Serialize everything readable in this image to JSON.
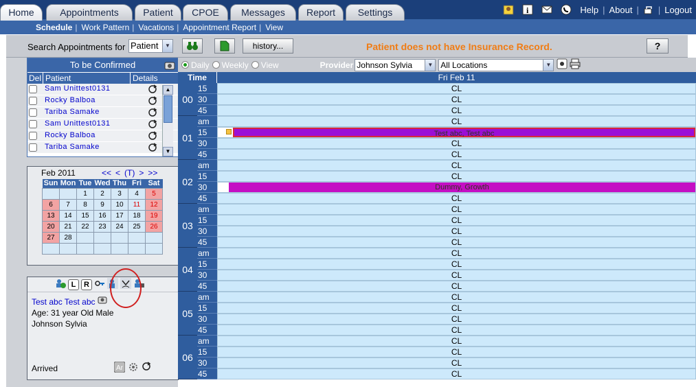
{
  "tabs": [
    {
      "label": "Home",
      "active": true
    },
    {
      "label": "Appointments",
      "active": false
    },
    {
      "label": "Patient",
      "active": false
    },
    {
      "label": "CPOE",
      "active": false
    },
    {
      "label": "Messages",
      "active": false
    },
    {
      "label": "Report",
      "active": false
    },
    {
      "label": "Settings",
      "active": false
    }
  ],
  "top_links": {
    "help": "Help",
    "about": "About",
    "logout": "Logout"
  },
  "subnav": [
    "Schedule",
    "Work Pattern",
    "Vacations",
    "Appointment Report",
    "View"
  ],
  "search": {
    "label": "Search Appointments for",
    "selected": "Patient",
    "history_button": "history..."
  },
  "warning": "Patient does not have Insurance Record.",
  "help_button": "?",
  "to_confirm": {
    "title": "To be Confirmed",
    "columns": [
      "Del",
      "Patient",
      "Details"
    ],
    "rows": [
      "Sam Unittest0131",
      "Rocky Balboa",
      "Tariba Samake",
      "Sam Unittest0131",
      "Rocky Balboa",
      "Tariba Samake"
    ]
  },
  "calendar": {
    "month": "Feb 2011",
    "nav": [
      "<<",
      "<",
      "(T)",
      ">",
      ">>"
    ],
    "weekdays": [
      "Sun",
      "Mon",
      "Tue",
      "Wed",
      "Thu",
      "Fri",
      "Sat"
    ],
    "weeks": [
      [
        "",
        "",
        "1",
        "2",
        "3",
        "4",
        "5"
      ],
      [
        "6",
        "7",
        "8",
        "9",
        "10",
        "11",
        "12"
      ],
      [
        "13",
        "14",
        "15",
        "16",
        "17",
        "18",
        "19"
      ],
      [
        "20",
        "21",
        "22",
        "23",
        "24",
        "25",
        "26"
      ],
      [
        "27",
        "28",
        "",
        "",
        "",
        "",
        ""
      ],
      [
        "",
        "",
        "",
        "",
        "",
        "",
        ""
      ]
    ],
    "today": "11"
  },
  "patient_info": {
    "name": "Test abc Test abc",
    "age": "Age: 31 year  Old Male",
    "provider": "Johnson Sylvia",
    "status": "Arrived",
    "icon_letters": [
      "L",
      "R"
    ]
  },
  "view_bar": {
    "modes": [
      "Daily",
      "Weekly",
      "View"
    ],
    "selected_mode": "Daily",
    "provider_label": "Provider",
    "provider": "Johnson Sylvia",
    "location": "All Locations"
  },
  "schedule": {
    "time_header": "Time",
    "day_header": "Fri Feb 11",
    "hours": [
      "00",
      "01",
      "02",
      "03",
      "04",
      "05",
      "06"
    ],
    "slot_labels": [
      "am",
      "15",
      "30",
      "45"
    ],
    "cell_text": "CL",
    "appointments": [
      {
        "hour": "01",
        "slot": "15",
        "text": "Test abc, Test abc",
        "color": "#9b0fd6"
      },
      {
        "hour": "02",
        "slot": "30",
        "text": "Dummy, Growth",
        "color": "#c40fc4"
      }
    ]
  }
}
